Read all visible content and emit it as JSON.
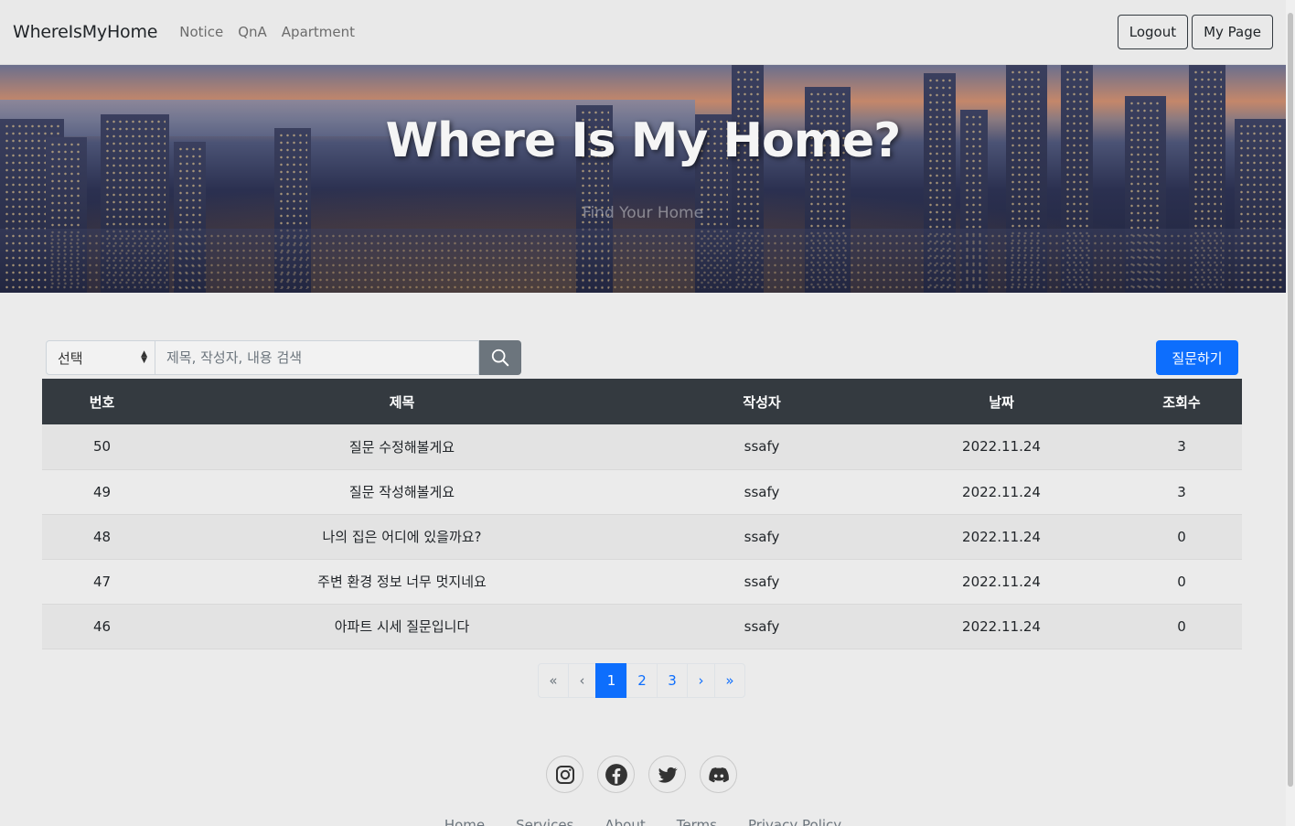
{
  "navbar": {
    "brand": "WhereIsMyHome",
    "links": [
      "Notice",
      "QnA",
      "Apartment"
    ],
    "logout_label": "Logout",
    "mypage_label": "My Page"
  },
  "hero": {
    "title": "Where Is My Home?",
    "subtitle": "Find Your Home"
  },
  "search": {
    "select_value": "선택",
    "placeholder": "제목, 작성자, 내용 검색"
  },
  "ask_button": "질문하기",
  "table": {
    "headers": [
      "번호",
      "제목",
      "작성자",
      "날짜",
      "조회수"
    ],
    "rows": [
      {
        "no": "50",
        "title": "질문 수정해볼게요",
        "author": "ssafy",
        "date": "2022.11.24",
        "views": "3"
      },
      {
        "no": "49",
        "title": "질문 작성해볼게요",
        "author": "ssafy",
        "date": "2022.11.24",
        "views": "3"
      },
      {
        "no": "48",
        "title": "나의 집은 어디에 있을까요?",
        "author": "ssafy",
        "date": "2022.11.24",
        "views": "0"
      },
      {
        "no": "47",
        "title": "주변 환경 정보 너무 멋지네요",
        "author": "ssafy",
        "date": "2022.11.24",
        "views": "0"
      },
      {
        "no": "46",
        "title": "아파트 시세 질문입니다",
        "author": "ssafy",
        "date": "2022.11.24",
        "views": "0"
      }
    ]
  },
  "pagination": {
    "first": "«",
    "prev": "‹",
    "pages": [
      "1",
      "2",
      "3"
    ],
    "next": "›",
    "last": "»",
    "current": "1"
  },
  "socials": [
    "instagram-icon",
    "facebook-icon",
    "twitter-icon",
    "discord-icon"
  ],
  "footer_links": [
    "Home",
    "Services",
    "About",
    "Terms",
    "Privacy Policy"
  ],
  "colors": {
    "primary": "#0d6efd",
    "table_header": "#343a40",
    "background": "#ebebeb"
  }
}
